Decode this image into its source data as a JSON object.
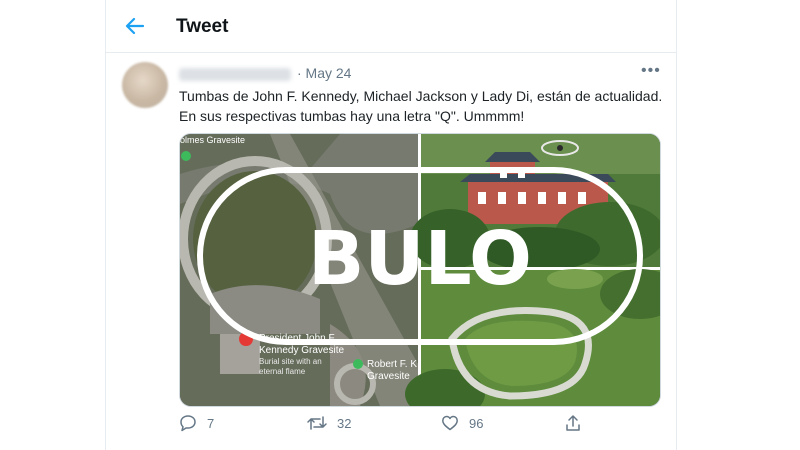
{
  "header": {
    "title": "Tweet"
  },
  "tweet": {
    "date_label": "· May 24",
    "text_lines": [
      "Tumbas de John F. Kennedy, Michael Jackson y Lady Di, están de actualidad.",
      "En sus respectivas tumbas hay una letra \"Q\". Ummmm!"
    ],
    "image": {
      "stamp": "BULO",
      "map_labels": {
        "holmes": "olmes Gravesite",
        "jfk_1": "President John F.",
        "jfk_2": "Kennedy Gravesite",
        "jfk_3": "Burial site with an",
        "jfk_4": "eternal flame",
        "rfk_1": "Robert F. K",
        "rfk_2": "Gravesite"
      }
    },
    "actions": {
      "replies": "7",
      "retweets": "32",
      "likes": "96"
    }
  },
  "colors": {
    "accent": "#1da1f2",
    "muted": "#657786",
    "stamp": "#ffffff"
  },
  "icons": [
    "back-arrow-icon",
    "more-icon",
    "reply-icon",
    "retweet-icon",
    "like-icon",
    "share-icon",
    "map-pin-icon"
  ]
}
